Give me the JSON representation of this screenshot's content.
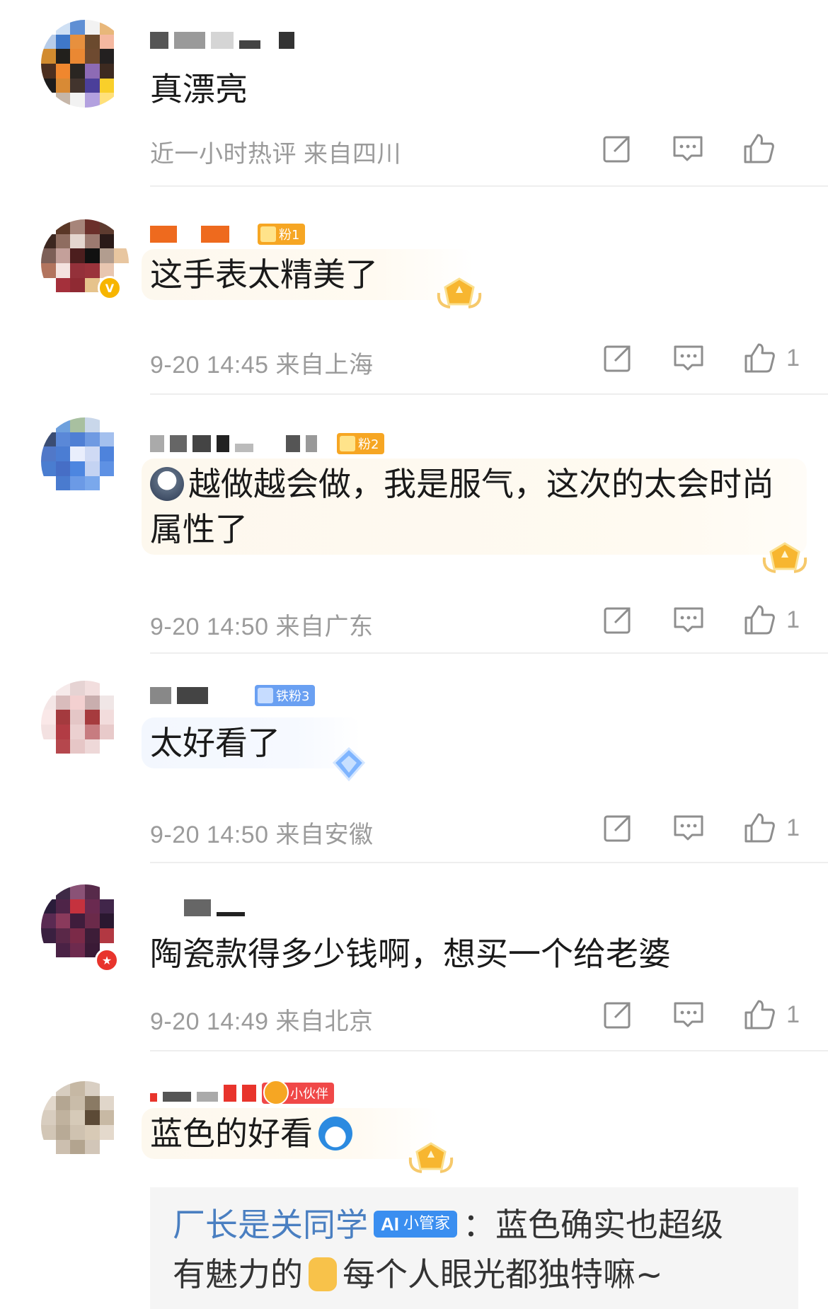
{
  "comments": [
    {
      "text": "真漂亮",
      "time": "近一小时热评",
      "location": "来自四川",
      "likes": "",
      "avatar_colors": [
        "#fff",
        "#cfe0f4",
        "#5f8fd4",
        "#f2f2f2",
        "#e8b77a",
        "#fff",
        "#b7cce9",
        "#3f78c9",
        "#e7903e",
        "#6b4a2e",
        "#f5b8a0",
        "#fff",
        "#d28b2f",
        "#22201c",
        "#ea8833",
        "#6e4a30",
        "#232020",
        "#ffffff",
        "#4c2f20",
        "#f0872e",
        "#2a2622",
        "#8d6bb5",
        "#3d2a20",
        "#fff",
        "#1d1c1c",
        "#d88a35",
        "#42342d",
        "#4b3f9a",
        "#f9cf2a",
        "#fff",
        "#ffffff",
        "#c6b6a8",
        "#f2f2f2",
        "#b3a1df",
        "#ffe07a",
        "#fff"
      ]
    },
    {
      "fan_badge": "粉1",
      "text": "这手表太精美了",
      "time": "9-20 14:45",
      "location": "来自上海",
      "likes": "1",
      "avatar_colors": [
        "#fff",
        "#5a3726",
        "#a7857a",
        "#6b2f2a",
        "#5d3b2f",
        "#fff",
        "#3c2720",
        "#8f6d60",
        "#e4d6cf",
        "#9c7a70",
        "#2a1a18",
        "#fff",
        "#7d5f57",
        "#c4a09a",
        "#4c1e1e",
        "#111",
        "#b29d8f",
        "#e8c6a0",
        "#b2745e",
        "#f4e3e0",
        "#94313a",
        "#9a333b",
        "#e8c6b0",
        "#fff",
        "#fff",
        "#a4303b",
        "#8f2a33",
        "#e6c38c",
        "#ffffff",
        "#fff",
        "#ffffff",
        "#ffffff",
        "#ffffff",
        "#ffffff",
        "#ffffff",
        "#fff"
      ]
    },
    {
      "fan_badge": "粉2",
      "text": "越做越会做，我是服气，这次的太会时尚属性了",
      "time": "9-20 14:50",
      "location": "来自广东",
      "likes": "1",
      "avatar_colors": [
        "#fff",
        "#6ea0dd",
        "#a8c0a0",
        "#c9d7ea",
        "#fff",
        "#fff",
        "#3b4d73",
        "#5a88d8",
        "#4f7fd4",
        "#6f9ae2",
        "#a4c0ee",
        "#fff",
        "#5178c8",
        "#4b7dd3",
        "#e9eefc",
        "#cfdaf4",
        "#4e83dc",
        "#fff",
        "#4a7dd0",
        "#466ec6",
        "#4d86e0",
        "#c4d3f2",
        "#5e91e4",
        "#fff",
        "#fff",
        "#4a7bcf",
        "#6b9ae6",
        "#7aa8ec",
        "#fff",
        "#fff",
        "#ffffff",
        "#ffffff",
        "#ffffff",
        "#ffffff",
        "#ffffff",
        "#fff"
      ]
    },
    {
      "fan_badge": "铁粉3",
      "text": "太好看了",
      "time": "9-20 14:50",
      "location": "来自安徽",
      "likes": "1",
      "avatar_colors": [
        "#fff",
        "#f6eaea",
        "#e6d3d3",
        "#f2dede",
        "#fff",
        "#fff",
        "#f4e6e6",
        "#d9bcbc",
        "#f3d0d0",
        "#c9aeae",
        "#f0e6e6",
        "#fff",
        "#fae8e8",
        "#a43a3e",
        "#e4c6c6",
        "#a63b3e",
        "#f2dcdc",
        "#fff",
        "#f3e1e1",
        "#b23c44",
        "#ebd0d0",
        "#c77c80",
        "#e8caca",
        "#fff",
        "#fff",
        "#b5474d",
        "#e6c6c6",
        "#eed8d8",
        "#fff",
        "#fff",
        "#ffffff",
        "#ffffff",
        "#ffffff",
        "#ffffff",
        "#ffffff",
        "#fff"
      ]
    },
    {
      "text": "陶瓷款得多少钱啊，想买一个给老婆",
      "time": "9-20 14:49",
      "location": "来自北京",
      "likes": "1",
      "avatar_colors": [
        "#fff",
        "#3e2a46",
        "#8a5276",
        "#572a4a",
        "#fff",
        "#fff",
        "#2a1c3a",
        "#4e2448",
        "#c5323e",
        "#6a2a50",
        "#41264a",
        "#fff",
        "#5a2a52",
        "#8a3a5c",
        "#3f1d3c",
        "#6b2a4a",
        "#2a1830",
        "#fff",
        "#3a2040",
        "#5a2848",
        "#7b2a48",
        "#3d1d38",
        "#b23842",
        "#fff",
        "#fff",
        "#4a2245",
        "#6e2a4e",
        "#3a1a36",
        "#fff",
        "#fff",
        "#ffffff",
        "#ffffff",
        "#ffffff",
        "#ffffff",
        "#ffffff",
        "#fff"
      ]
    },
    {
      "badge_label": "小伙伴",
      "text": "蓝色的好看",
      "time": "",
      "location": "",
      "likes": "",
      "avatar_colors": [
        "#fff",
        "#d7cdc0",
        "#c6b8a4",
        "#d9cfc3",
        "#fff",
        "#fff",
        "#e2d8cc",
        "#b4a692",
        "#c9bca9",
        "#8a7a64",
        "#e0d6ca",
        "#fff",
        "#d8cdbf",
        "#c0b29e",
        "#d6cab8",
        "#5c4a36",
        "#c8b9a4",
        "#fff",
        "#d2c6b6",
        "#b8aa96",
        "#cfc2b0",
        "#d8cab6",
        "#e4d9cc",
        "#fff",
        "#fff",
        "#ccbfaf",
        "#b3a48f",
        "#d2c6b8",
        "#fff",
        "#fff",
        "#ffffff",
        "#ffffff",
        "#ffffff",
        "#ffffff",
        "#ffffff",
        "#fff"
      ]
    }
  ],
  "reply": {
    "author": "厂长是关同学",
    "ai_badge_icon": "AI",
    "ai_badge_label": "小管家",
    "separator": "：",
    "line1_rest": "蓝色确实也超级",
    "line2a": "有魅力的",
    "line2b": "每个人眼光都独特嘛~"
  },
  "colors": {
    "meta_gray": "#9b9b9b",
    "reply_author_blue": "#4a7fc1",
    "fan_badge_orange": "#f6a623",
    "fan_badge_blue": "#6aa0f2",
    "partner_red": "#f04848"
  }
}
